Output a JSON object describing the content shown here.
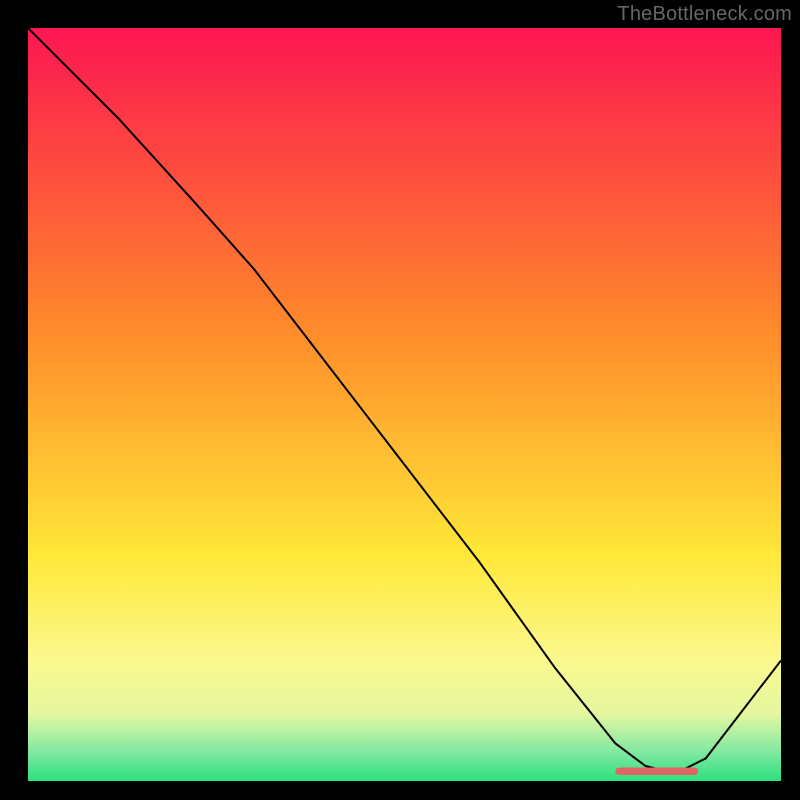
{
  "watermark": "TheBottleneck.com",
  "chart_data": {
    "type": "line",
    "title": "",
    "xlabel": "",
    "ylabel": "",
    "xlim": [
      0,
      100
    ],
    "ylim": [
      0,
      100
    ],
    "gradient_stops": [
      {
        "offset": 0,
        "color": "#fc1651"
      },
      {
        "offset": 40,
        "color": "#ff8a2a"
      },
      {
        "offset": 70,
        "color": "#ffe838"
      },
      {
        "offset": 84,
        "color": "#fbf88e"
      },
      {
        "offset": 91,
        "color": "#e5f7a0"
      },
      {
        "offset": 96,
        "color": "#85e9a2"
      },
      {
        "offset": 100,
        "color": "#2be07f"
      }
    ],
    "series": [
      {
        "name": "bottleneck-curve",
        "color": "#000000",
        "x": [
          0,
          12,
          22,
          30,
          40,
          50,
          60,
          70,
          78,
          82,
          86,
          90,
          100
        ],
        "y": [
          100,
          88,
          77,
          68,
          55,
          42,
          29,
          15,
          5,
          2,
          1,
          3,
          16
        ]
      }
    ],
    "marker": {
      "name": "range-marker",
      "color": "#e06666",
      "x_start": 78,
      "x_end": 89,
      "y": 1.3,
      "thickness": 1.0
    }
  }
}
